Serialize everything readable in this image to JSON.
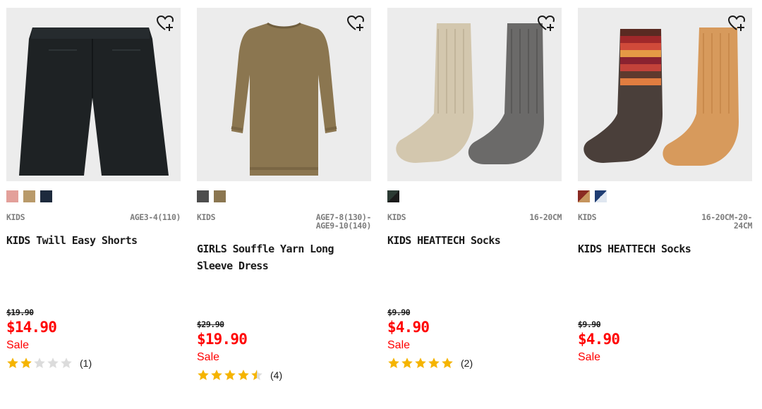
{
  "colors": {
    "sale": "#ff0000",
    "star": "#f5b400",
    "star_empty": "#dcdcdc",
    "image_bg": "#ececec"
  },
  "products": [
    {
      "category": "KIDS",
      "size": "AGE3-4(110)",
      "name": "KIDS Twill Easy Shorts",
      "original_price": "$19.90",
      "sale_price": "$14.90",
      "sale_label": "Sale",
      "rating": 2,
      "review_count": "(1)",
      "swatches": [
        "#e3a09a",
        "#b99a6a",
        "#1d2a3d"
      ],
      "wishlist_icon": "heart-plus-icon"
    },
    {
      "category": "KIDS",
      "size": "AGE7-8(130)-\nAGE9-10(140)",
      "name": "GIRLS Souffle Yarn Long Sleeve Dress",
      "original_price": "$29.90",
      "sale_price": "$19.90",
      "sale_label": "Sale",
      "rating": 4.5,
      "review_count": "(4)",
      "swatches": [
        "#4d4d4d",
        "#8b7650"
      ],
      "wishlist_icon": "heart-plus-icon"
    },
    {
      "category": "KIDS",
      "size": "16-20CM",
      "name": "KIDS HEATTECH Socks",
      "original_price": "$9.90",
      "sale_price": "$4.90",
      "sale_label": "Sale",
      "rating": 5,
      "review_count": "(2)",
      "swatches": [
        "split:#2b3a33:#1b1b1b"
      ],
      "wishlist_icon": "heart-plus-icon"
    },
    {
      "category": "KIDS",
      "size": "16-20CM-20-\n24CM",
      "name": "KIDS HEATTECH Socks",
      "original_price": "$9.90",
      "sale_price": "$4.90",
      "sale_label": "Sale",
      "rating": null,
      "review_count": "",
      "swatches": [
        "split:#8a2a22:#c6955e",
        "split:#1f3d73:#dfe6f0"
      ],
      "wishlist_icon": "heart-plus-icon"
    }
  ]
}
